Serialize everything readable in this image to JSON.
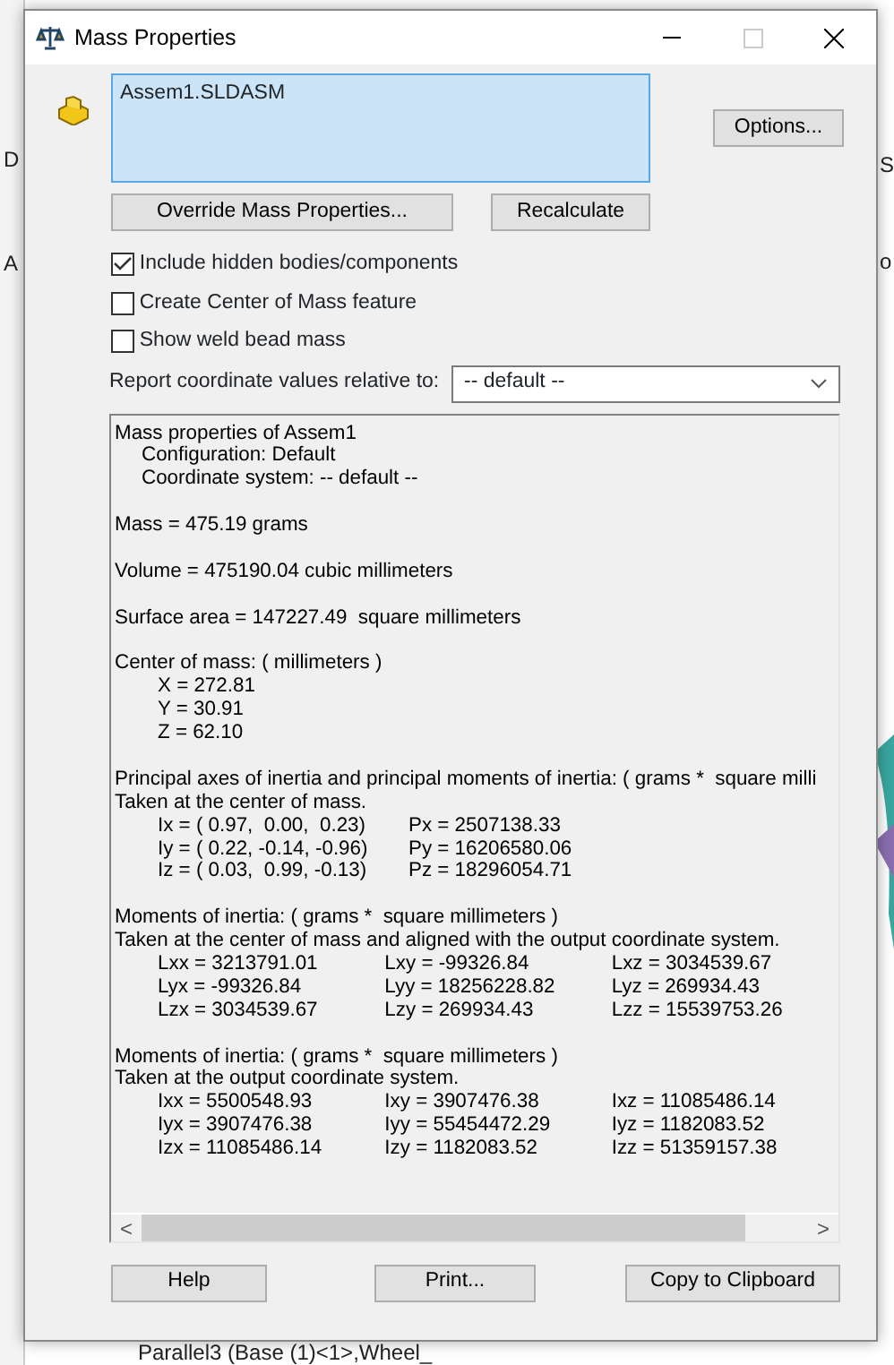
{
  "background": {
    "right_texts": [
      "S",
      "o"
    ],
    "left_texts": [
      "D",
      "A"
    ],
    "tree_item": "Parallel3 (Base (1)<1>,Wheel_"
  },
  "window": {
    "title": "Mass Properties"
  },
  "selection": {
    "items": [
      "Assem1.SLDASM"
    ]
  },
  "buttons_top": [
    "Override Mass Properties...",
    "Recalculate"
  ],
  "options_button": "Options...",
  "checkboxes": [
    {
      "label": "Include hidden bodies/components",
      "checked": true
    },
    {
      "label": "Create Center of Mass feature",
      "checked": false
    },
    {
      "label": "Show weld bead mass",
      "checked": false
    }
  ],
  "coordinate": {
    "label": "Report coordinate values relative to:",
    "value": "-- default --"
  },
  "report": [
    {
      "kind": "line",
      "text": "Mass properties of Assem1"
    },
    {
      "kind": "sub",
      "text": "Configuration: Default"
    },
    {
      "kind": "sub",
      "text": "Coordinate system: -- default --"
    },
    {
      "kind": "gap"
    },
    {
      "kind": "line",
      "text": "Mass = 475.19 grams"
    },
    {
      "kind": "gap"
    },
    {
      "kind": "line",
      "text": "Volume = 475190.04 cubic millimeters"
    },
    {
      "kind": "gap"
    },
    {
      "kind": "line",
      "text": "Surface area = 147227.49  square millimeters"
    },
    {
      "kind": "gap"
    },
    {
      "kind": "line",
      "text": "Center of mass: ( millimeters )"
    },
    {
      "kind": "row",
      "cells": [
        "X = 272.81"
      ]
    },
    {
      "kind": "row",
      "cells": [
        "Y = 30.91"
      ]
    },
    {
      "kind": "row",
      "cells": [
        "Z = 62.10"
      ]
    },
    {
      "kind": "gap"
    },
    {
      "kind": "line",
      "text": "Principal axes of inertia and principal moments of inertia: ( grams *  square milli"
    },
    {
      "kind": "line",
      "text": "Taken at the center of mass."
    },
    {
      "kind": "row",
      "cells": [
        "Ix = ( 0.97,  0.00,  0.23)",
        "Px = 2507138.33"
      ]
    },
    {
      "kind": "row",
      "cells": [
        "Iy = ( 0.22, -0.14, -0.96)",
        "Py = 16206580.06"
      ]
    },
    {
      "kind": "row",
      "cells": [
        "Iz = ( 0.03,  0.99, -0.13)",
        "Pz = 18296054.71"
      ]
    },
    {
      "kind": "gap"
    },
    {
      "kind": "line",
      "text": "Moments of inertia: ( grams *  square millimeters )"
    },
    {
      "kind": "line",
      "text": "Taken at the center of mass and aligned with the output coordinate system."
    },
    {
      "kind": "row",
      "cells": [
        "Lxx = 3213791.01",
        "Lxy = -99326.84",
        "Lxz = 3034539.67"
      ]
    },
    {
      "kind": "row",
      "cells": [
        "Lyx = -99326.84",
        "Lyy = 18256228.82",
        "Lyz = 269934.43"
      ]
    },
    {
      "kind": "row",
      "cells": [
        "Lzx = 3034539.67",
        "Lzy = 269934.43",
        "Lzz = 15539753.26"
      ]
    },
    {
      "kind": "gap"
    },
    {
      "kind": "line",
      "text": "Moments of inertia: ( grams *  square millimeters )"
    },
    {
      "kind": "line",
      "text": "Taken at the output coordinate system."
    },
    {
      "kind": "row",
      "cells": [
        "Ixx = 5500548.93",
        "Ixy = 3907476.38",
        "Ixz = 11085486.14"
      ]
    },
    {
      "kind": "row",
      "cells": [
        "Iyx = 3907476.38",
        "Iyy = 55454472.29",
        "Iyz = 1182083.52"
      ]
    },
    {
      "kind": "row",
      "cells": [
        "Izx = 11085486.14",
        "Izy = 1182083.52",
        "Izz = 51359157.38"
      ]
    }
  ],
  "report_scrollbar": {
    "left": "<",
    "right": ">"
  },
  "buttons_bottom": [
    "Help",
    "Print...",
    "Copy to Clipboard"
  ]
}
